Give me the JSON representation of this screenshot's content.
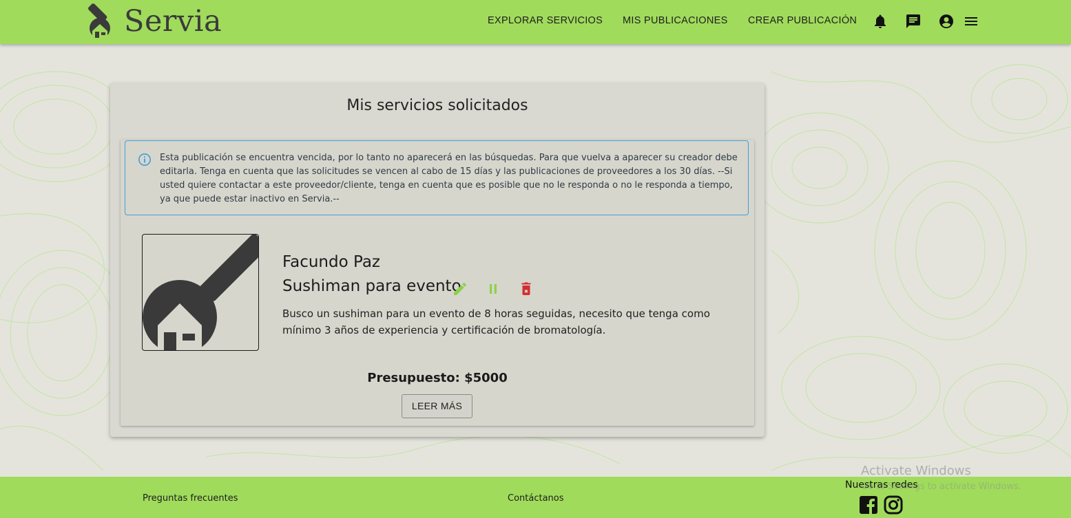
{
  "header": {
    "logo_text": "Servia",
    "nav": [
      {
        "label": "EXPLORAR SERVICIOS"
      },
      {
        "label": "MIS PUBLICACIONES"
      },
      {
        "label": "CREAR PUBLICACIÓN"
      }
    ],
    "icons": [
      "bell-icon",
      "chat-icon",
      "account-icon",
      "menu-icon"
    ]
  },
  "main": {
    "title": "Mis servicios solicitados",
    "alert": {
      "icon": "info-icon",
      "text": "Esta publicación se encuentra vencida, por lo tanto no aparecerá en las búsquedas. Para que vuelva a aparecer su creador debe editarla. Tenga en cuenta que las solicitudes se vencen al cabo de 15 días y las publicaciones de proveedores a los 30 días. --Si usted quiere contactar a este proveedor/cliente, tenga en cuenta que es posible que no le responda o no le responda a tiempo, ya que puede estar inactivo en Servia.--",
      "color": "#3f9ed9"
    },
    "post": {
      "author": "Facundo Paz",
      "title": "Sushiman para evento",
      "description": "Busco un sushiman para un evento de 8 horas seguidas, necesito que tenga como mínimo 3 años de experiencia y certificación de bromatología.",
      "budget": "Presupuesto: $5000",
      "read_more_label": "LEER MÁS",
      "actions": [
        "edit-icon",
        "pause-icon",
        "delete-icon"
      ],
      "action_colors": {
        "edit": "#8cd14a",
        "pause": "#8cd14a",
        "delete": "#d32f2f"
      }
    }
  },
  "footer": {
    "faq_label": "Preguntas frecuentes",
    "contact_label": "Contáctanos",
    "social_title": "Nuestras redes",
    "social_icons": [
      "facebook-icon",
      "instagram-icon"
    ]
  },
  "watermark": {
    "title": "Activate Windows",
    "subtitle": "Go to Settings to activate Windows."
  },
  "colors": {
    "brand_green": "#a0db5c",
    "background": "#e4e4dd",
    "card": "#d9d8d1"
  }
}
